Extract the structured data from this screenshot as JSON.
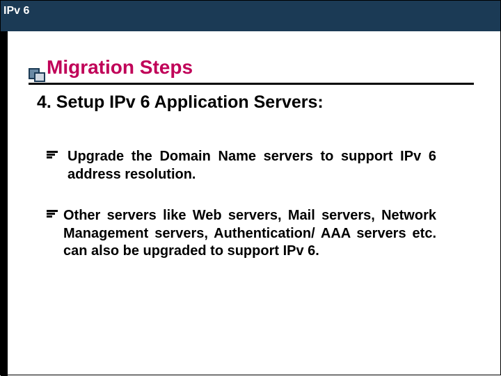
{
  "header": {
    "label": "IPv 6"
  },
  "title": "Migration Steps",
  "subtitle": "4. Setup IPv 6 Application Servers:",
  "bullets": [
    {
      "text": "Upgrade the Domain Name servers to support IPv 6 address resolution."
    },
    {
      "text": "Other servers like Web servers, Mail servers, Network Management servers, Authentication/ AAA servers etc. can also be upgraded to support IPv 6."
    }
  ],
  "colors": {
    "header_band": "#1b3a55",
    "title": "#c00058"
  }
}
